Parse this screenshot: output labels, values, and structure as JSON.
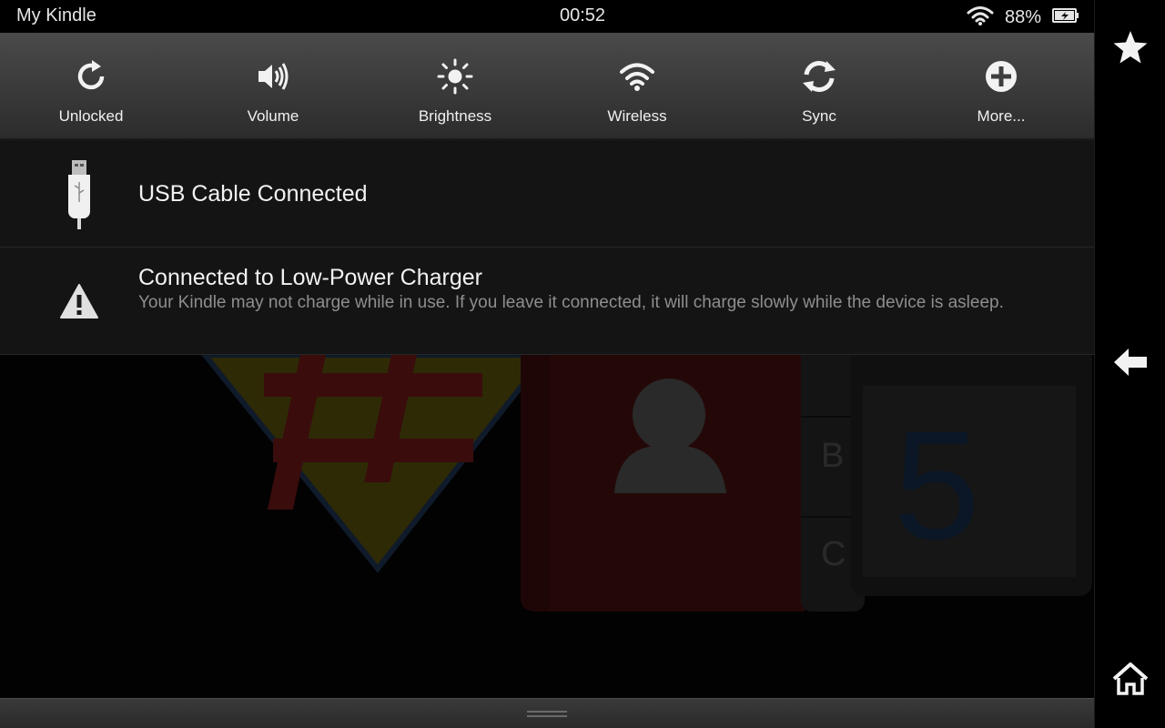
{
  "status_bar": {
    "title": "My Kindle",
    "time": "00:52",
    "battery_percent": "88%",
    "wifi_icon": "wifi-icon",
    "battery_icon": "battery-charging-icon"
  },
  "quick_settings": [
    {
      "label": "Unlocked",
      "icon": "rotation-unlocked-icon"
    },
    {
      "label": "Volume",
      "icon": "volume-icon"
    },
    {
      "label": "Brightness",
      "icon": "brightness-icon"
    },
    {
      "label": "Wireless",
      "icon": "wifi-icon"
    },
    {
      "label": "Sync",
      "icon": "sync-icon"
    },
    {
      "label": "More...",
      "icon": "plus-circle-icon"
    }
  ],
  "notifications": [
    {
      "title": "USB Cable Connected",
      "body": "",
      "icon": "usb-cable-icon"
    },
    {
      "title": "Connected to Low-Power Charger",
      "body": "Your Kindle may not charge while in use. If you leave it connected, it will charge slowly while the device is asleep.",
      "icon": "warning-icon"
    }
  ],
  "background": {
    "calendar_day": "5",
    "index_letters": [
      "B",
      "C"
    ]
  },
  "nav_bar": {
    "favorites_icon": "star-icon",
    "back_icon": "back-arrow-icon",
    "home_icon": "home-icon"
  },
  "colors": {
    "quick_settings_bg": "#3e3e3e",
    "notification_bg": "#141414",
    "body_text": "#8e8e8e"
  }
}
